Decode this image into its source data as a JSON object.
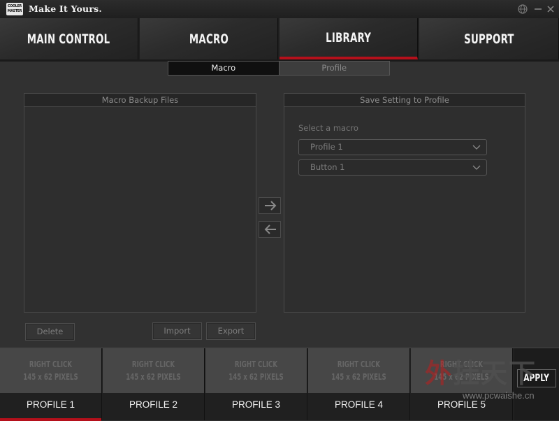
{
  "titlebar": {
    "logo_line1": "COOLER",
    "logo_line2": "MASTER",
    "title": "Make It Yours.",
    "controls": [
      "globe-icon",
      "minimize-icon",
      "close-icon"
    ]
  },
  "nav": {
    "tabs": [
      {
        "label": "MAIN CONTROL",
        "active": false
      },
      {
        "label": "MACRO",
        "active": false
      },
      {
        "label": "LIBRARY",
        "active": true
      },
      {
        "label": "SUPPORT",
        "active": false
      }
    ],
    "accent": "#b5101b"
  },
  "subtabs": [
    {
      "label": "Macro",
      "active": true
    },
    {
      "label": "Profile",
      "active": false
    }
  ],
  "left_panel": {
    "title": "Macro Backup Files",
    "items": []
  },
  "right_panel": {
    "title": "Save Setting to Profile",
    "select_label": "Select a macro",
    "profile_dropdown": "Profile 1",
    "button_dropdown": "Button 1"
  },
  "buttons": {
    "delete": "Delete",
    "import": "Import",
    "export": "Export",
    "apply": "APPLY"
  },
  "profiles": [
    {
      "image_line1": "RIGHT CLICK",
      "image_line2": "145 x 62 PIXELS",
      "name": "PROFILE 1",
      "active": true
    },
    {
      "image_line1": "RIGHT CLICK",
      "image_line2": "145 x 62 PIXELS",
      "name": "PROFILE 2",
      "active": false
    },
    {
      "image_line1": "RIGHT CLICK",
      "image_line2": "145 x 62 PIXELS",
      "name": "PROFILE 3",
      "active": false
    },
    {
      "image_line1": "RIGHT CLICK",
      "image_line2": "145 x 62 PIXELS",
      "name": "PROFILE 4",
      "active": false
    },
    {
      "image_line1": "RIGHT CLICK",
      "image_line2": "145 x 62 PIXELS",
      "name": "PROFILE 5",
      "active": false
    }
  ],
  "watermark": {
    "text1": "外",
    "text2": "挂天下",
    "url": "www.pcwaishe.cn"
  }
}
